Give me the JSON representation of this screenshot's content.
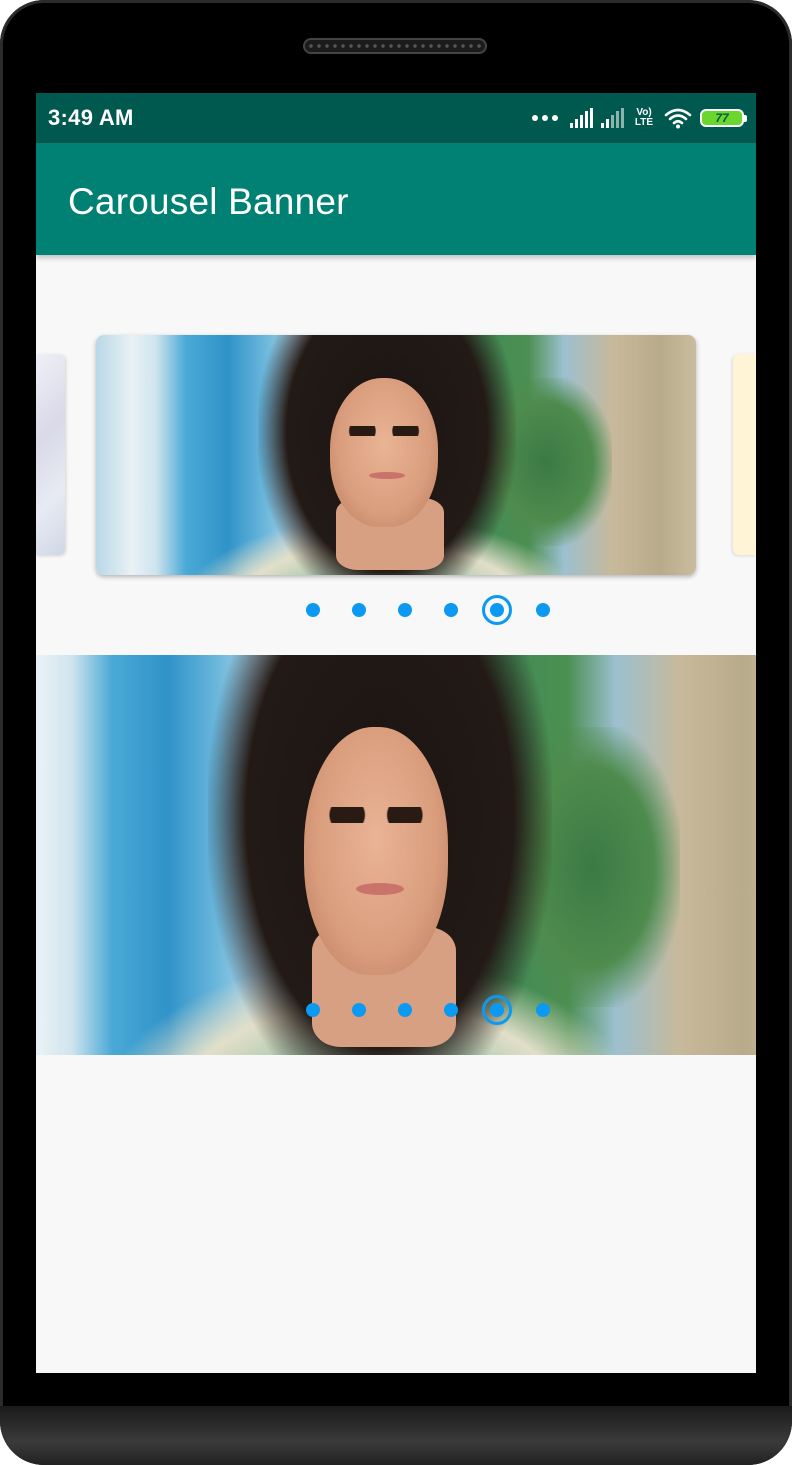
{
  "status_bar": {
    "time": "3:49 AM",
    "network": "Vo) LTE",
    "battery": "77",
    "accent_color": "#00594f"
  },
  "app_bar": {
    "title": "Carousel Banner",
    "color": "#008173"
  },
  "carousel": {
    "slide_count": 6,
    "active_index": 4,
    "indicator_color": "#0c99f2"
  },
  "banner": {
    "slide_count": 6,
    "active_index": 4
  }
}
